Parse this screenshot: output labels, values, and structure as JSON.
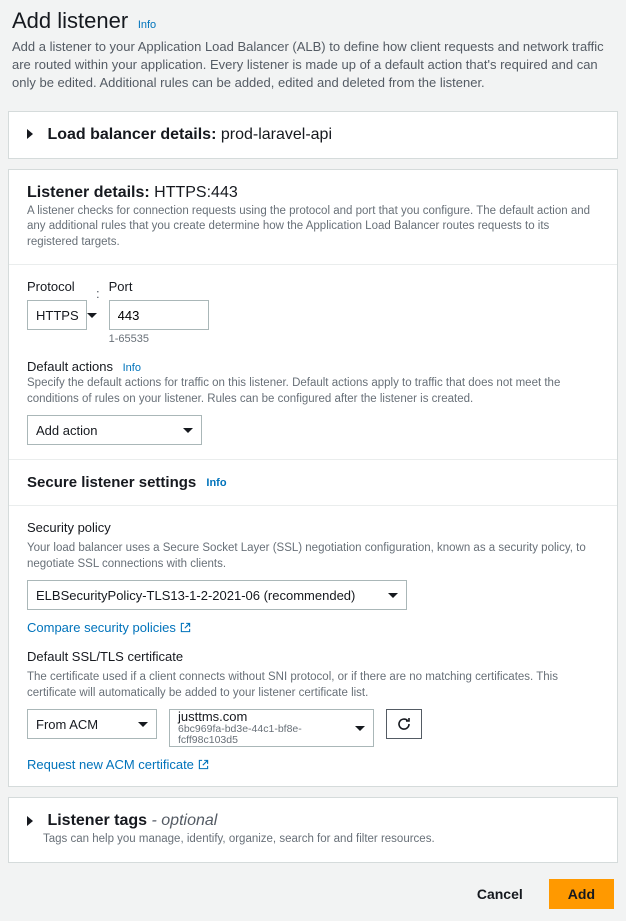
{
  "header": {
    "title": "Add listener",
    "info_label": "Info",
    "description": "Add a listener to your Application Load Balancer (ALB) to define how client requests and network traffic are routed within your application. Every listener is made up of a default action that's required and can only be edited. Additional rules can be added, edited and deleted from the listener."
  },
  "lb_details": {
    "label": "Load balancer details:",
    "value": "prod-laravel-api"
  },
  "listener_details": {
    "label": "Listener details:",
    "value": "HTTPS:443",
    "description": "A listener checks for connection requests using the protocol and port that you configure. The default action and any additional rules that you create determine how the Application Load Balancer routes requests to its registered targets.",
    "protocol_label": "Protocol",
    "protocol_value": "HTTPS",
    "port_label": "Port",
    "port_value": "443",
    "port_help": "1-65535"
  },
  "default_actions": {
    "label": "Default actions",
    "info_label": "Info",
    "description": "Specify the default actions for traffic on this listener. Default actions apply to traffic that does not meet the conditions of rules on your listener. Rules can be configured after the listener is created.",
    "add_action_label": "Add action"
  },
  "secure_settings": {
    "heading": "Secure listener settings",
    "info_label": "Info",
    "security_policy_label": "Security policy",
    "security_policy_desc": "Your load balancer uses a Secure Socket Layer (SSL) negotiation configuration, known as a security policy, to negotiate SSL connections with clients.",
    "security_policy_value": "ELBSecurityPolicy-TLS13-1-2-2021-06 (recommended)",
    "compare_link": "Compare security policies",
    "cert_label": "Default SSL/TLS certificate",
    "cert_desc": "The certificate used if a client connects without SNI protocol, or if there are no matching certificates. This certificate will automatically be added to your listener certificate list.",
    "cert_source_value": "From ACM",
    "cert_domain": "justtms.com",
    "cert_id": "6bc969fa-bd3e-44c1-bf8e-fcff98c103d5",
    "request_cert_link": "Request new ACM certificate"
  },
  "tags": {
    "label": "Listener tags",
    "optional": " - optional",
    "desc": "Tags can help you manage, identify, organize, search for and filter resources."
  },
  "footer": {
    "cancel": "Cancel",
    "add": "Add"
  }
}
